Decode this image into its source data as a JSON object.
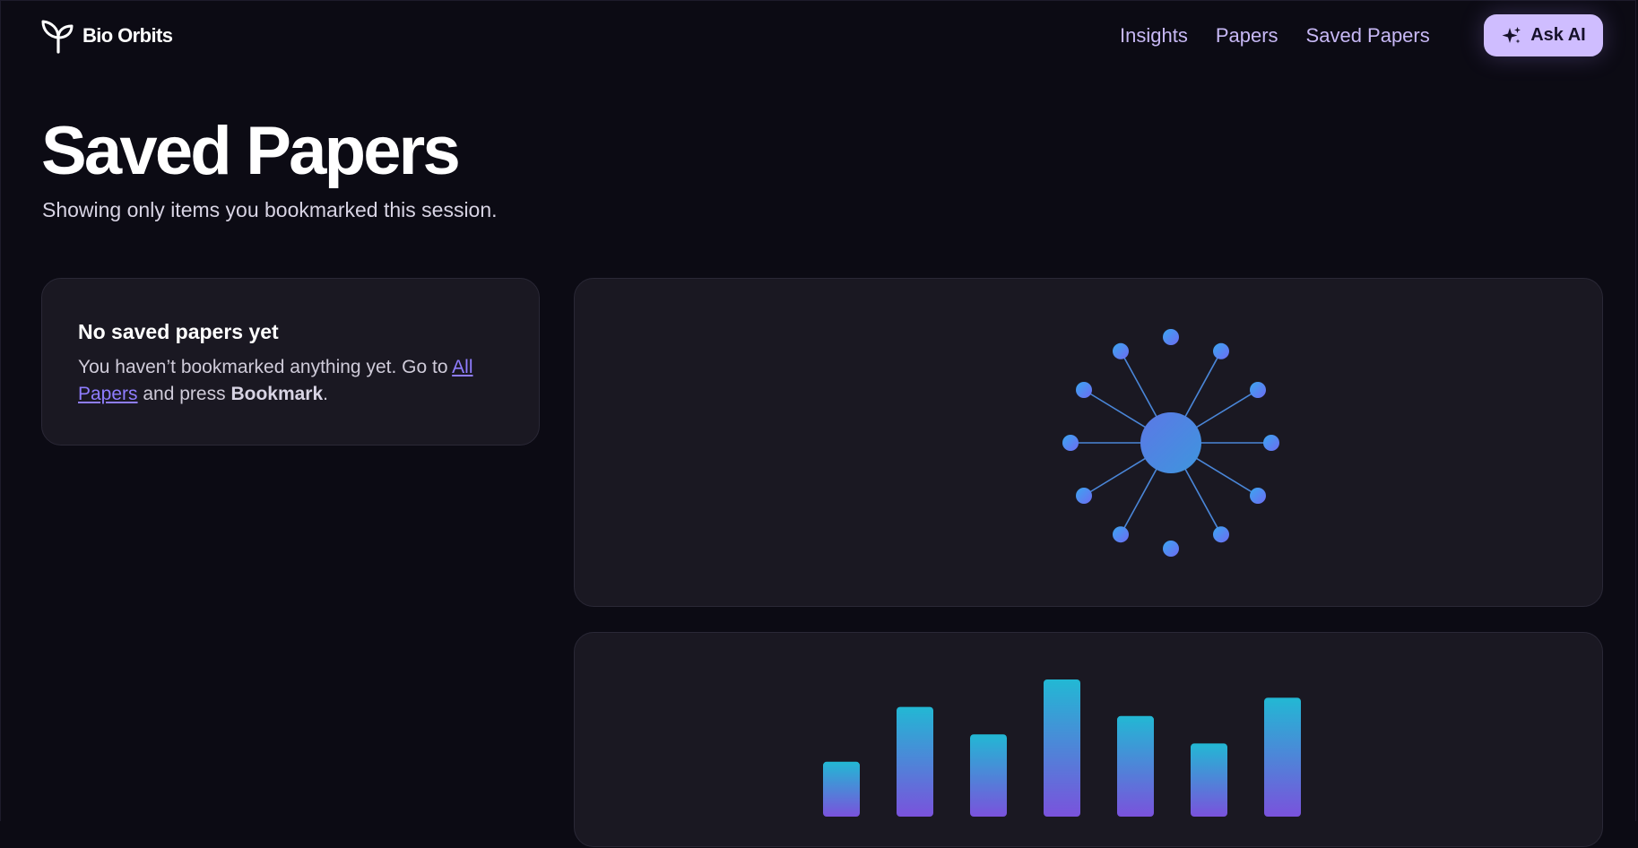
{
  "app": {
    "name": "Bio Orbits",
    "logo_icon": "sprout-icon"
  },
  "nav": {
    "links": [
      "Insights",
      "Papers",
      "Saved Papers"
    ],
    "ask_label": "Ask AI",
    "ask_icon": "sparkles-icon"
  },
  "page": {
    "title": "Saved Papers",
    "subtitle": "Showing only items you bookmarked this session."
  },
  "empty_state": {
    "title": "No saved papers yet",
    "text_before": "You haven’t bookmarked anything yet. Go to ",
    "link_text": "All Papers",
    "text_middle": " and press ",
    "strong_text": "Bookmark",
    "text_after": "."
  },
  "colors": {
    "background": "#0c0b14",
    "card": "#1a1822",
    "accent": "#cfbdff",
    "link": "#8f7dff",
    "gradient_start": "#22b8d4",
    "gradient_end": "#7a52dc"
  },
  "chart_data": {
    "type": "bar",
    "categories": [
      "",
      "",
      "",
      "",
      "",
      "",
      ""
    ],
    "values": [
      60,
      120,
      90,
      150,
      110,
      80,
      130
    ],
    "title": "",
    "xlabel": "",
    "ylabel": ""
  }
}
